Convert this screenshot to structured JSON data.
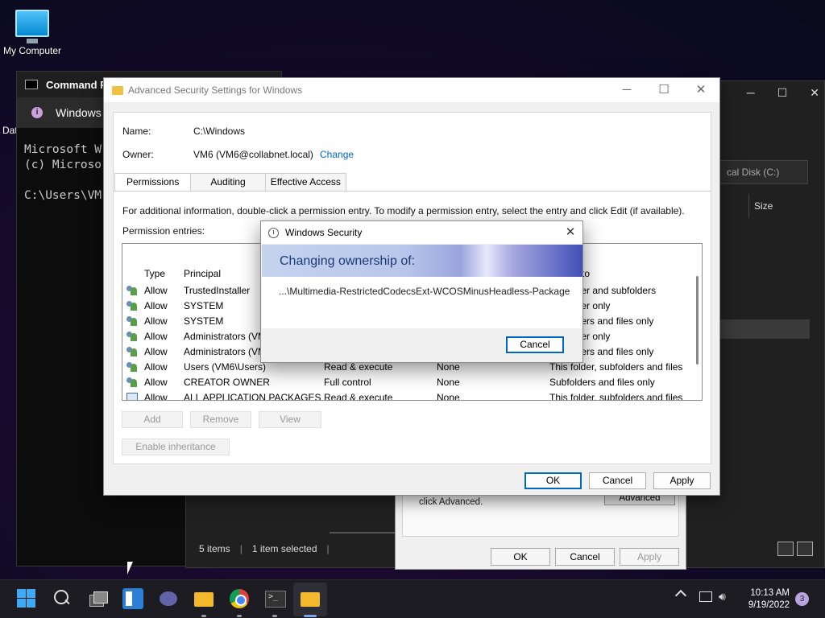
{
  "desktop": {
    "icon_label": "My Computer",
    "partial_label": "Dat"
  },
  "console": {
    "tab_title": "Command P",
    "info_text": "Windows",
    "lines": [
      "Microsoft W",
      "(c) Microso",
      "",
      "C:\\Users\\VM"
    ]
  },
  "explorer": {
    "address_text": "cal Disk (C:)",
    "col_size": "Size",
    "status_items": "5 items",
    "status_selected": "1 item selected"
  },
  "props": {
    "text": "click Advanced.",
    "advanced_label": "Advanced",
    "ok": "OK",
    "cancel": "Cancel",
    "apply": "Apply"
  },
  "adv": {
    "title": "Advanced Security Settings for Windows",
    "name_label": "Name:",
    "name_value": "C:\\Windows",
    "owner_label": "Owner:",
    "owner_value": "VM6 (VM6@collabnet.local)",
    "change_link": "Change",
    "tabs": [
      "Permissions",
      "Auditing",
      "Effective Access"
    ],
    "info": "For additional information, double-click a permission entry. To modify a permission entry, select the entry and click Edit (if available).",
    "entries_label": "Permission entries:",
    "columns": {
      "type": "Type",
      "principal": "Principal",
      "applies": "to"
    },
    "rows": [
      {
        "type": "Allow",
        "principal": "TrustedInstaller",
        "access": "",
        "inherited": "",
        "applies": "lder and subfolders"
      },
      {
        "type": "Allow",
        "principal": "SYSTEM",
        "access": "",
        "inherited": "",
        "applies": "lder only"
      },
      {
        "type": "Allow",
        "principal": "SYSTEM",
        "access": "",
        "inherited": "",
        "applies": "lders and files only"
      },
      {
        "type": "Allow",
        "principal": "Administrators (VM",
        "access": "",
        "inherited": "",
        "applies": "lder only"
      },
      {
        "type": "Allow",
        "principal": "Administrators (VM",
        "access": "",
        "inherited": "",
        "applies": "lders and files only"
      },
      {
        "type": "Allow",
        "principal": "Users (VM6\\Users)",
        "access": "Read & execute",
        "inherited": "None",
        "applies": "This folder, subfolders and files"
      },
      {
        "type": "Allow",
        "principal": "CREATOR OWNER",
        "access": "Full control",
        "inherited": "None",
        "applies": "Subfolders and files only"
      },
      {
        "type": "Allow",
        "principal": "ALL APPLICATION PACKAGES",
        "access": "Read & execute",
        "inherited": "None",
        "applies": "This folder, subfolders and files"
      }
    ],
    "add": "Add",
    "remove": "Remove",
    "view": "View",
    "enable_inheritance": "Enable inheritance",
    "ok": "OK",
    "cancel": "Cancel",
    "apply": "Apply"
  },
  "sec": {
    "title": "Windows Security",
    "heading": "Changing ownership of:",
    "path": "...\\Multimedia-RestrictedCodecsExt-WCOSMinusHeadless-Package",
    "cancel": "Cancel"
  },
  "taskbar": {
    "time": "10:13 AM",
    "date": "9/19/2022",
    "notification_count": "3"
  }
}
